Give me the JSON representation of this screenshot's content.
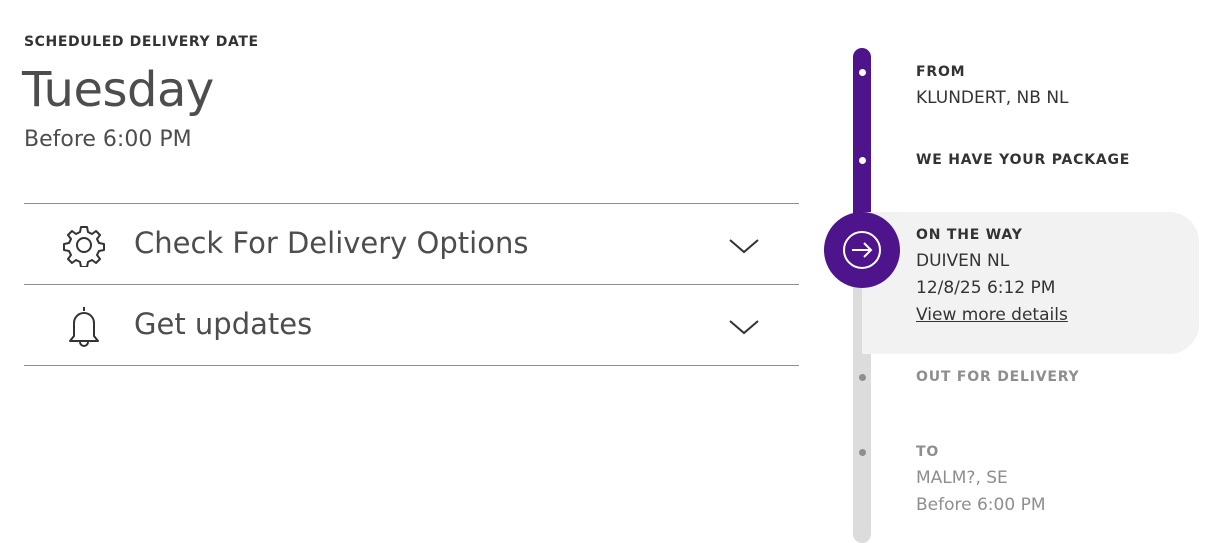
{
  "delivery": {
    "label": "SCHEDULED DELIVERY DATE",
    "day": "Tuesday",
    "time": "Before 6:00 PM"
  },
  "options": [
    {
      "label": "Check For Delivery Options",
      "icon": "gear-icon"
    },
    {
      "label": "Get updates",
      "icon": "bell-icon"
    }
  ],
  "timeline": {
    "from": {
      "title": "FROM",
      "location": "KLUNDERT, NB NL"
    },
    "have_package": {
      "title": "WE HAVE YOUR PACKAGE"
    },
    "on_the_way": {
      "title": "ON THE WAY",
      "location": "DUIVEN NL",
      "datetime": "12/8/25 6:12 PM",
      "link": "View more details"
    },
    "out_for_delivery": {
      "title": "OUT FOR DELIVERY"
    },
    "to": {
      "title": "TO",
      "location": "MALM?, SE",
      "time": "Before 6:00 PM"
    }
  },
  "colors": {
    "brand_purple": "#4d148c",
    "track_grey": "#dcdcdc",
    "muted_text": "#8e8e8e",
    "highlight_bg": "#f2f2f2"
  }
}
